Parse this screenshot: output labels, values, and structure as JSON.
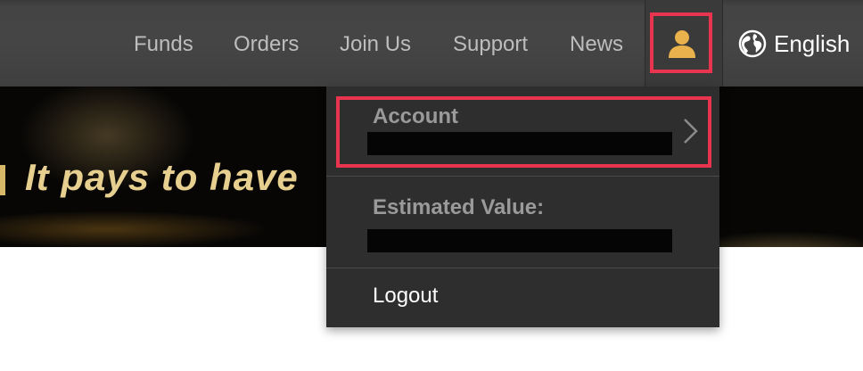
{
  "nav": {
    "links": [
      "Funds",
      "Orders",
      "Join Us",
      "Support",
      "News"
    ],
    "language": "English"
  },
  "banner": {
    "text": "It pays to have"
  },
  "account_menu": {
    "account_label": "Account",
    "estimated_value_label": "Estimated Value:",
    "logout_label": "Logout"
  },
  "colors": {
    "highlight": "#e8344e",
    "user_icon": "#e9b24c",
    "nav_bg": "#454545",
    "menu_bg": "#2e2e2e"
  },
  "icons": [
    "user-icon",
    "globe-icon",
    "chevron-right-icon"
  ]
}
